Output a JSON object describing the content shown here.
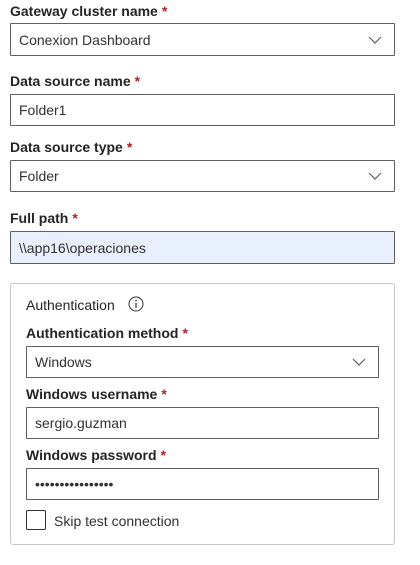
{
  "gateway_cluster": {
    "label": "Gateway cluster name",
    "required_mark": "*",
    "value": "Conexion Dashboard"
  },
  "data_source_name": {
    "label": "Data source name",
    "required_mark": "*",
    "value": "Folder1"
  },
  "data_source_type": {
    "label": "Data source type",
    "required_mark": "*",
    "value": "Folder"
  },
  "full_path": {
    "label": "Full path",
    "required_mark": "*",
    "value": "\\\\app16\\operaciones"
  },
  "authentication": {
    "title": "Authentication",
    "info_icon": "info-icon",
    "method": {
      "label": "Authentication method",
      "required_mark": "*",
      "value": "Windows"
    },
    "username": {
      "label": "Windows username",
      "required_mark": "*",
      "value": "sergio.guzman"
    },
    "password": {
      "label": "Windows password",
      "required_mark": "*",
      "value": "••••••••••••••••"
    },
    "skip_test": {
      "label": "Skip test connection",
      "checked": false
    }
  },
  "colors": {
    "required": "#a4262c",
    "border": "#605e5c",
    "autofill_background": "#e8f0fe",
    "text": "#252423"
  }
}
